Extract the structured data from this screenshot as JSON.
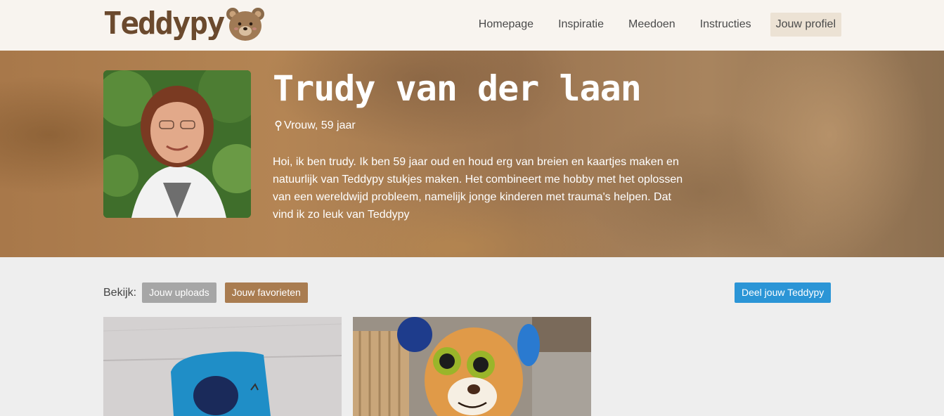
{
  "header": {
    "logo_text": "Teddypy",
    "nav": [
      {
        "label": "Homepage"
      },
      {
        "label": "Inspiratie"
      },
      {
        "label": "Meedoen"
      },
      {
        "label": "Instructies"
      },
      {
        "label": "Jouw profiel",
        "active": true
      }
    ]
  },
  "profile": {
    "name": "Trudy van der laan",
    "meta": "Vrouw, 59 jaar",
    "bio": "Hoi, ik ben trudy. Ik ben 59 jaar oud en houd erg van breien en kaartjes maken en natuurlijk van Teddypy stukjes maken. Het combineert me hobby met het oplossen van een wereldwijd probleem, namelijk jonge kinderen met trauma's helpen. Dat vind ik zo leuk van Teddypy"
  },
  "filters": {
    "label": "Bekijk:",
    "uploads_label": "Jouw uploads",
    "favorites_label": "Jouw favorieten",
    "share_label": "Deel jouw Teddypy"
  },
  "colors": {
    "accent_brown": "#a97c50",
    "share_blue": "#2b95d6",
    "logo_brown": "#6b4a2e"
  }
}
